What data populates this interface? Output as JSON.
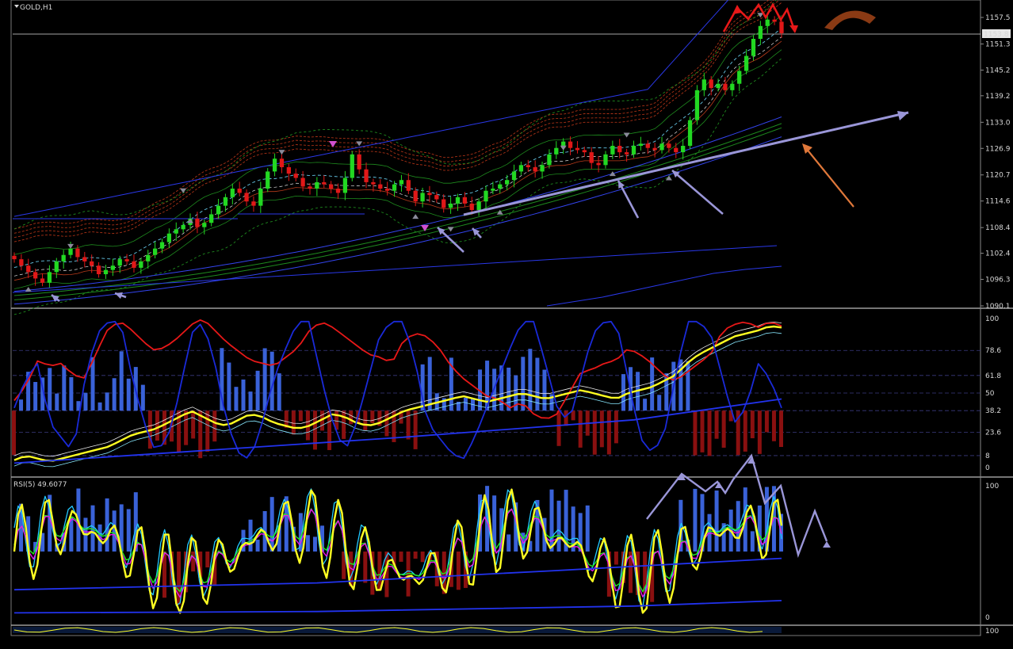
{
  "main": {
    "title": "GOLD,H1",
    "price_ticks": [
      "1157.5",
      "1151.3",
      "1145.2",
      "1139.2",
      "1133.0",
      "1126.9",
      "1120.7",
      "1114.6",
      "1108.4",
      "1102.4",
      "1096.3",
      "1090.1"
    ],
    "current_price": "1153.8"
  },
  "stoch_panel": {
    "levels": [
      "100",
      "78.6",
      "61.8",
      "50",
      "38.2",
      "23.6",
      "8",
      "0"
    ]
  },
  "rsi_panel": {
    "label": "RSI(5) 49.6077",
    "levels": [
      "100",
      "0"
    ]
  },
  "bottom_strip": {
    "tick": "100"
  },
  "colors": {
    "background": "#000000",
    "bull_candle": "#22d822",
    "bear_candle": "#e01818",
    "ribbon_red": "#c83a1a",
    "ribbon_green": "#1e8a1e",
    "ribbon_blue": "#2233dd",
    "annotation": "#9a96d8",
    "orange_arrow": "#e0783a",
    "histogram_blue": "#3a62d8",
    "histogram_red": "#8a1010",
    "stoch_red": "#e81818",
    "stoch_yellow": "#ffff22",
    "stoch_blue": "#1a2ad8",
    "rsi_yellow": "#ffff22",
    "rsi_cyan": "#22c8ff"
  },
  "chart_data": [
    {
      "type": "line",
      "title": "GOLD,H1",
      "ylim": [
        1090.1,
        1160.6
      ],
      "series": [
        {
          "name": "close",
          "values": [
            1101.0,
            1099.5,
            1098.0,
            1096.5,
            1095.5,
            1098.0,
            1100.5,
            1102.0,
            1103.5,
            1101.5,
            1100.5,
            1099.5,
            1097.5,
            1098.5,
            1099.5,
            1101.0,
            1100.5,
            1099.0,
            1100.5,
            1102.0,
            1103.5,
            1105.0,
            1107.0,
            1108.0,
            1109.0,
            1110.5,
            1108.5,
            1109.5,
            1111.5,
            1113.5,
            1115.5,
            1117.5,
            1116.5,
            1114.5,
            1113.5,
            1117.5,
            1121.5,
            1124.5,
            1122.5,
            1121.0,
            1120.0,
            1118.0,
            1117.5,
            1119.0,
            1118.5,
            1117.5,
            1116.5,
            1120.0,
            1125.5,
            1122.0,
            1119.0,
            1118.5,
            1117.5,
            1117.0,
            1118.5,
            1119.5,
            1117.0,
            1114.5,
            1116.5,
            1116.0,
            1115.0,
            1113.0,
            1114.0,
            1115.5,
            1114.0,
            1112.5,
            1114.5,
            1117.0,
            1117.5,
            1118.5,
            1119.5,
            1121.5,
            1123.0,
            1122.5,
            1121.5,
            1123.0,
            1125.5,
            1127.0,
            1128.5,
            1127.0,
            1126.5,
            1126.0,
            1123.5,
            1123.0,
            1125.5,
            1127.5,
            1126.0,
            1125.5,
            1127.5,
            1128.0,
            1127.0,
            1126.5,
            1128.0,
            1127.0,
            1126.0,
            1127.5,
            1133.5,
            1140.5,
            1143.0,
            1141.0,
            1142.0,
            1140.5,
            1142.0,
            1145.0,
            1148.5,
            1152.5,
            1155.5,
            1157.0,
            1156.5,
            1153.8
          ]
        }
      ]
    },
    {
      "type": "line",
      "ylim": [
        0,
        100
      ],
      "series": [
        {
          "name": "red",
          "values": [
            45,
            55,
            72,
            68,
            70,
            62,
            60,
            78,
            94,
            98,
            92,
            84,
            78,
            82,
            88,
            96,
            100,
            92,
            84,
            78,
            72,
            70,
            68,
            74,
            80,
            92,
            98,
            94,
            88,
            82,
            76,
            74,
            70,
            86,
            90,
            88,
            80,
            68,
            60,
            54,
            48,
            46,
            40,
            44,
            36,
            32,
            36,
            50,
            64,
            66,
            70,
            72,
            80,
            76,
            70,
            62,
            58,
            64,
            70,
            76,
            92,
            96,
            98,
            94,
            98,
            95
          ]
        },
        {
          "name": "yellow",
          "values": [
            5,
            8,
            6,
            4,
            6,
            8,
            10,
            12,
            14,
            18,
            22,
            24,
            26,
            30,
            34,
            38,
            34,
            30,
            28,
            32,
            36,
            34,
            30,
            28,
            26,
            28,
            32,
            36,
            34,
            30,
            28,
            30,
            34,
            38,
            40,
            42,
            44,
            46,
            48,
            46,
            44,
            46,
            48,
            50,
            48,
            46,
            48,
            50,
            52,
            50,
            48,
            46,
            50,
            52,
            54,
            58,
            62,
            70,
            76,
            80,
            84,
            88,
            90,
            92,
            95,
            94
          ]
        },
        {
          "name": "blue",
          "values": [
            40,
            60,
            70,
            30,
            20,
            10,
            60,
            90,
            98,
            98,
            60,
            30,
            10,
            20,
            50,
            90,
            98,
            70,
            30,
            10,
            5,
            30,
            60,
            80,
            98,
            98,
            60,
            30,
            10,
            30,
            60,
            90,
            98,
            98,
            70,
            30,
            20,
            10,
            5,
            20,
            40,
            60,
            80,
            98,
            98,
            70,
            40,
            30,
            60,
            90,
            98,
            98,
            60,
            20,
            10,
            20,
            60,
            98,
            98,
            90,
            60,
            30,
            40,
            70,
            60,
            40
          ]
        }
      ]
    },
    {
      "type": "line",
      "ylim": [
        0,
        100
      ],
      "series": [
        {
          "name": "RSI(5)",
          "values": [
            49.6
          ]
        }
      ]
    }
  ]
}
